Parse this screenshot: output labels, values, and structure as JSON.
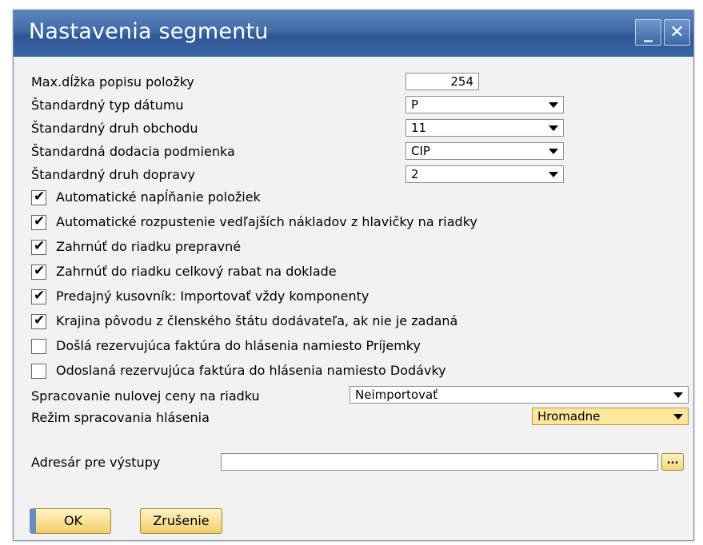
{
  "window": {
    "title": "Nastavenia segmentu",
    "minimize_glyph": "_",
    "close_glyph": "✕"
  },
  "fields": [
    {
      "label": "Max.dĺžka popisu položky",
      "value": "254"
    },
    {
      "label": "Štandardný typ dátumu",
      "value": "P"
    },
    {
      "label": "Štandardný druh obchodu",
      "value": "11"
    },
    {
      "label": "Štandardná dodacia podmienka",
      "value": "CIP"
    },
    {
      "label": "Štandardný druh dopravy",
      "value": "2"
    }
  ],
  "checkboxes": [
    {
      "label": "Automatické napĺňanie položiek",
      "checked": true
    },
    {
      "label": "Automatické rozpustenie vedľajších nákladov z hlavičky na riadky",
      "checked": true
    },
    {
      "label": "Zahrnúť do riadku prepravné",
      "checked": true
    },
    {
      "label": "Zahrnúť do riadku celkový rabat na doklade",
      "checked": true
    },
    {
      "label": "Predajný kusovník: Importovať vždy komponenty",
      "checked": true
    },
    {
      "label": "Krajina pôvodu z členského štátu dodávateľa, ak nie je zadaná",
      "checked": true
    },
    {
      "label": "Došlá rezervujúca faktúra do hlásenia namiesto Príjemky",
      "checked": false
    },
    {
      "label": "Odoslaná rezervujúca faktúra do hlásenia namiesto Dodávky",
      "checked": false
    }
  ],
  "check_mark": "✔",
  "zero_price": {
    "label": "Spracovanie nulovej ceny na riadku",
    "value": "Neimportovať"
  },
  "report_mode": {
    "label": "Režim spracovania hlásenia",
    "value": "Hromadne"
  },
  "output_dir": {
    "label": "Adresár pre výstupy",
    "value": "",
    "browse_label": "..."
  },
  "buttons": {
    "ok": "OK",
    "cancel": "Zrušenie"
  }
}
